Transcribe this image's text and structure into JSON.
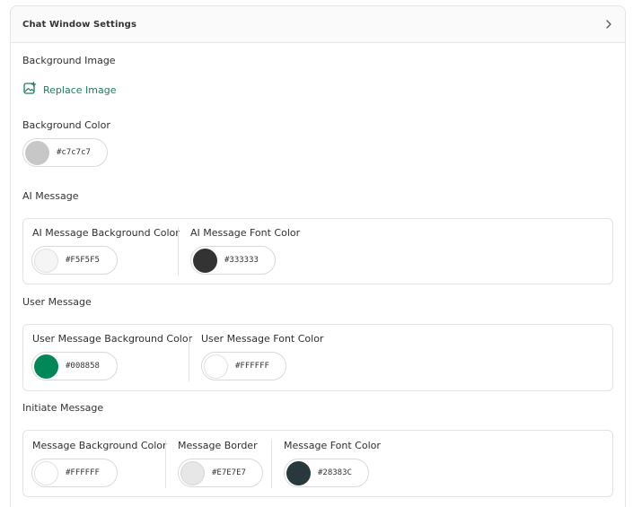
{
  "panel": {
    "title": "Chat Window Settings"
  },
  "background_image": {
    "label": "Background Image",
    "replace_label": "Replace Image"
  },
  "background_color": {
    "label": "Background Color",
    "value": "#c7c7c7",
    "swatch": "#c7c7c7"
  },
  "ai_message": {
    "title": "AI Message",
    "bg": {
      "label": "AI Message Background Color",
      "value": "#F5F5F5",
      "swatch": "#F5F5F5"
    },
    "font": {
      "label": "AI Message Font Color",
      "value": "#333333",
      "swatch": "#333333"
    }
  },
  "user_message": {
    "title": "User Message",
    "bg": {
      "label": "User Message Background Color",
      "value": "#008858",
      "swatch": "#008858"
    },
    "font": {
      "label": "User Message Font Color",
      "value": "#FFFFFF",
      "swatch": "#FFFFFF"
    }
  },
  "initiate_message": {
    "title": "Initiate Message",
    "bg": {
      "label": "Message Background Color",
      "value": "#FFFFFF",
      "swatch": "#FFFFFF"
    },
    "border": {
      "label": "Message Border",
      "value": "#E7E7E7",
      "swatch": "#E7E7E7"
    },
    "font": {
      "label": "Message Font Color",
      "value": "#28383C",
      "swatch": "#28383C"
    }
  },
  "colors": {
    "accent": "#1a7f5a",
    "border": "#e3e3e3"
  },
  "icons": {
    "header": "chevron-right-icon",
    "replace": "image-plus-icon"
  }
}
